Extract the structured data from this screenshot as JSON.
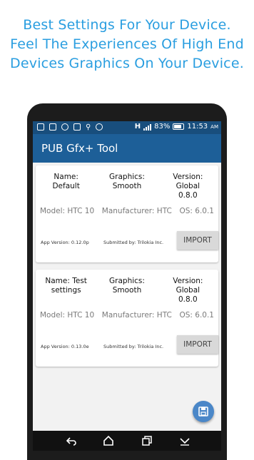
{
  "promo": {
    "line1": "Best Settings For Your Device.",
    "line2": "Feel The Experiences Of High End",
    "line3": "Devices Graphics On Your Device."
  },
  "status_bar": {
    "network": "H",
    "battery": "83%",
    "time": "11:53",
    "ampm": "AM"
  },
  "app_bar": {
    "title": "PUB Gfx+ Tool"
  },
  "configs": [
    {
      "name": "Name:\nDefault",
      "graphics": "Graphics:\nSmooth",
      "version": "Version: Global\n0.8.0",
      "model": "Model: HTC 10",
      "manufacturer": "Manufacturer: HTC",
      "os": "OS: 6.0.1",
      "app_version": "App Version: 0.12.0p",
      "submitted_by": "Submitted by: Trilokia Inc.",
      "import_label": "IMPORT"
    },
    {
      "name": "Name: Test\nsettings",
      "graphics": "Graphics:\nSmooth",
      "version": "Version: Global\n0.8.0",
      "model": "Model: HTC 10",
      "manufacturer": "Manufacturer: HTC",
      "os": "OS: 6.0.1",
      "app_version": "App Version: 0.13.0e",
      "submitted_by": "Submitted by: Trilokia Inc.",
      "import_label": "IMPORT"
    }
  ],
  "fab": {
    "icon": "save-icon"
  },
  "nav": {
    "icons": [
      "back-icon",
      "home-icon",
      "recents-icon",
      "hide-keyboard-icon"
    ]
  },
  "colors": {
    "promo": "#2a9ee0",
    "statusbar": "#184e7d",
    "appbar": "#1d5f98",
    "fab": "#4a87c8",
    "import_bg": "#d9d9d9"
  }
}
